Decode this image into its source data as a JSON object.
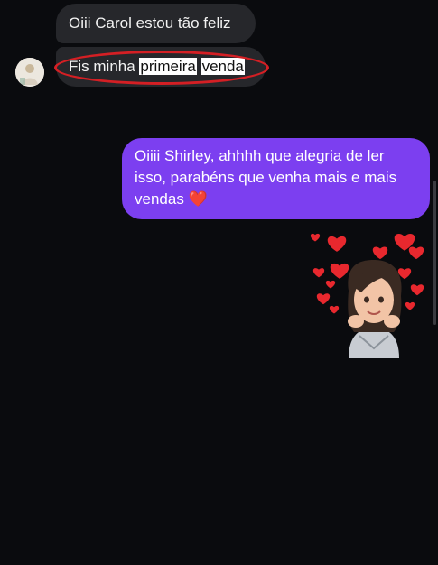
{
  "messages": {
    "received_1": "Oiii Carol estou tão feliz",
    "received_2": {
      "prefix": "Fis minha ",
      "highlight_1": "primeira",
      "highlight_2": "venda"
    },
    "sent_1": "Oiiii Shirley, ahhhh que alegria de ler isso, parabéns que venha mais e mais vendas ❤️"
  },
  "colors": {
    "background": "#0a0b0e",
    "received_bubble": "#26272b",
    "sent_bubble": "#7c3ff0",
    "annotation": "#d41f24",
    "heart": "#e8282e"
  },
  "icons": {
    "avatar": "contact-avatar",
    "sticker": "heart-memoji-sticker"
  }
}
